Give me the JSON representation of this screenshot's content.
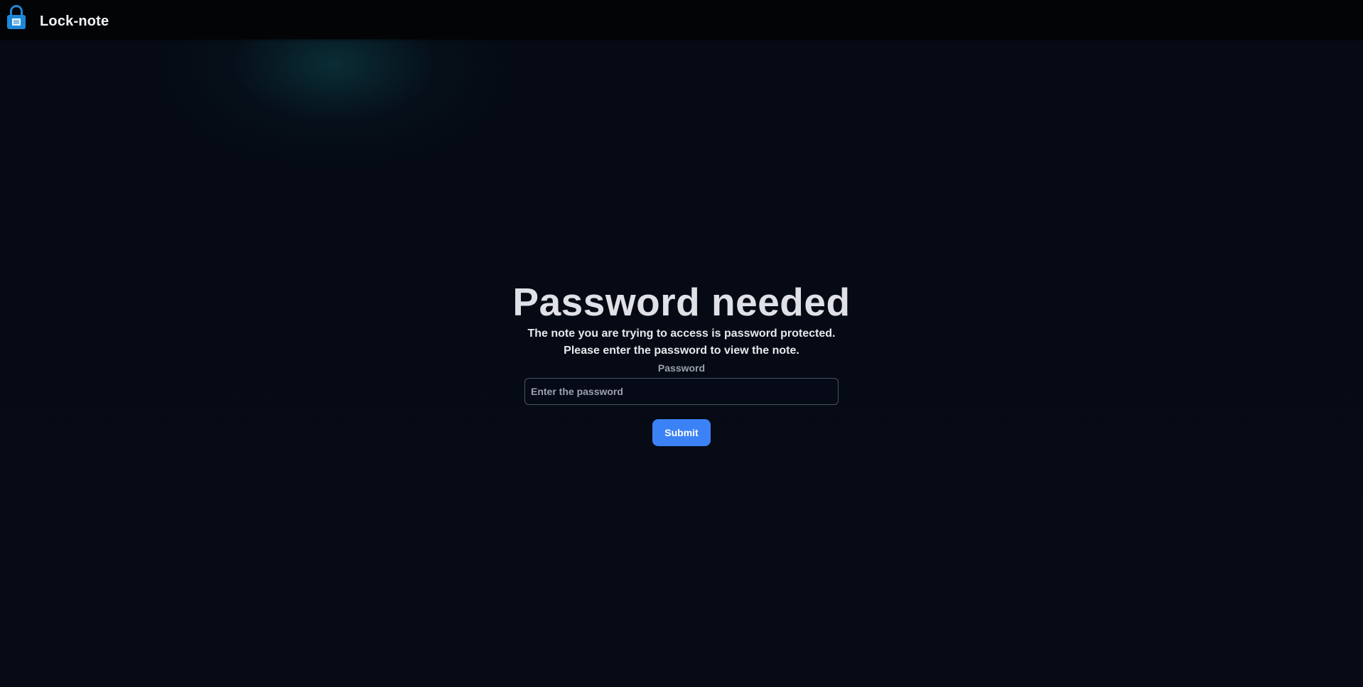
{
  "header": {
    "app_title": "Lock-note",
    "logo_icon": "lock-note-logo-icon"
  },
  "main": {
    "title": "Password needed",
    "description_line1": "The note you are trying to access is password protected.",
    "description_line2": "Please enter the password to view the note.",
    "password_label": "Password",
    "password_placeholder": "Enter the password",
    "password_value": "",
    "submit_label": "Submit"
  },
  "colors": {
    "accent": "#3b82f6",
    "background": "#050912",
    "topbar": "#030405"
  }
}
